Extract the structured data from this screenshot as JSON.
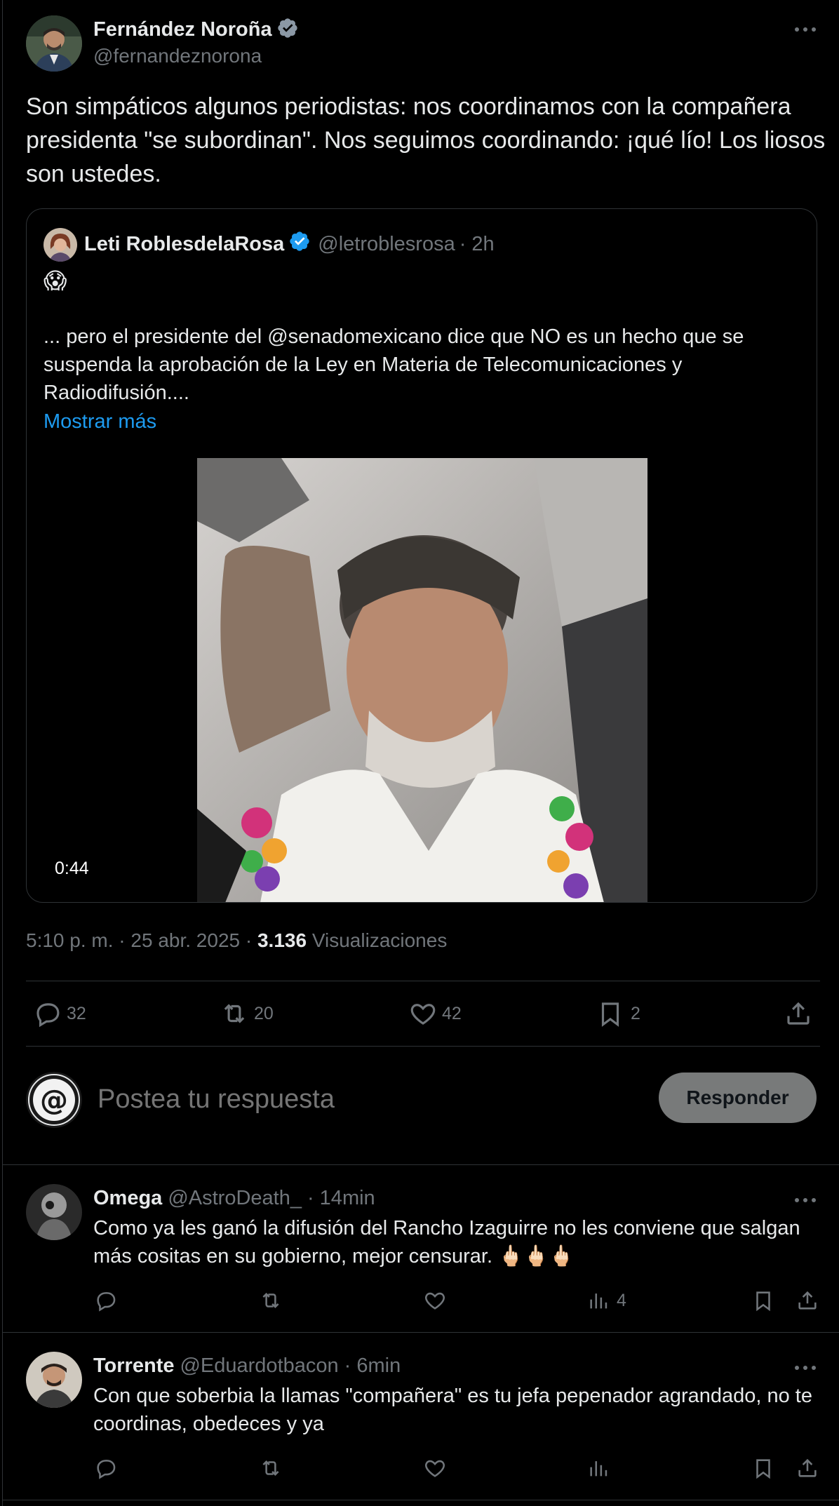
{
  "main_post": {
    "display_name": "Fernández Noroña",
    "handle": "@fernandeznorona",
    "text": "Son simpáticos algunos periodistas: nos coordinamos con la compañera presidenta \"se subordinan\". Nos seguimos coordinando: ¡qué lío! Los liosos son ustedes.",
    "timestamp": "5:10 p. m. · 25 abr. 2025 · ",
    "views_count": "3.136",
    "views_label": "Visualizaciones",
    "stats": {
      "replies": "32",
      "reposts": "20",
      "likes": "42",
      "bookmarks": "2"
    }
  },
  "quoted_post": {
    "display_name": "Leti RoblesdelaRosa",
    "handle": "@letroblesrosa",
    "time": "· 2h",
    "emoji": "😱",
    "text": "... pero el presidente del @senadomexicano dice que NO es un hecho que se suspenda la aprobación de la Ley en Materia de Telecomunicaciones y Radiodifusión....",
    "show_more": "Mostrar más",
    "video_duration": "0:44"
  },
  "composer": {
    "placeholder": "Postea tu respuesta",
    "button_label": "Responder"
  },
  "replies": [
    {
      "display_name": "Omega",
      "handle": "@AstroDeath_",
      "time": "· 14min",
      "text": "Como ya les ganó la difusión del Rancho Izaguirre no les conviene que salgan más cositas en su gobierno, mejor censurar. 🖕🏻🖕🏻🖕🏻",
      "views": "4"
    },
    {
      "display_name": "Torrente",
      "handle": "@Eduardotbacon",
      "time": "· 6min",
      "text": "Con que soberbia la llamas \"compañera\" es tu jefa pepenador agrandado, no te coordinas, obedeces y ya",
      "views": ""
    }
  ],
  "colors": {
    "background": "#000000",
    "text": "#e7e9ea",
    "muted": "#71767b",
    "link": "#1d9bf0",
    "verified": "#1d9bf0",
    "border": "#2f3336",
    "button_bg": "#787a7a"
  }
}
